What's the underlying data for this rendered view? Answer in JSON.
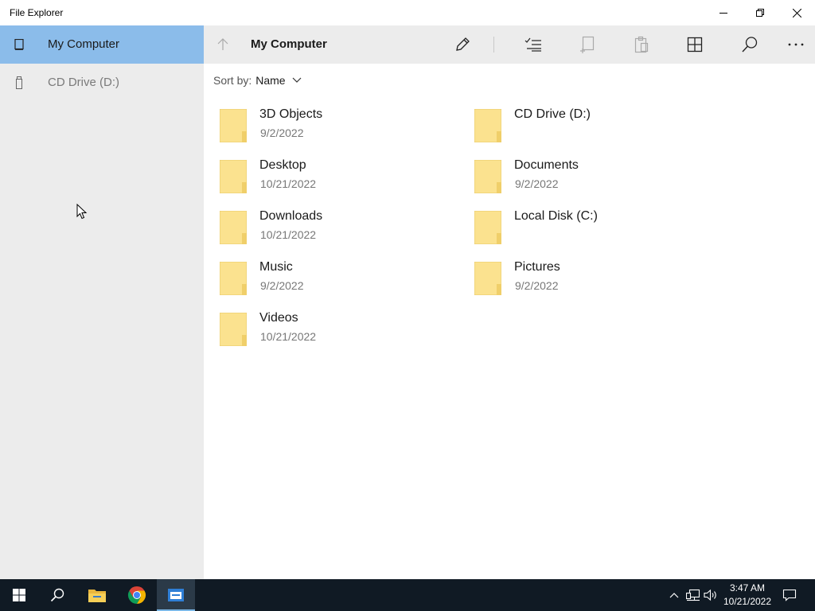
{
  "window": {
    "title": "File Explorer"
  },
  "sidebar": {
    "items": [
      {
        "label": "My Computer",
        "icon": "computer-icon",
        "selected": true
      },
      {
        "label": "CD Drive (D:)",
        "icon": "drive-icon",
        "selected": false
      }
    ]
  },
  "toolbar": {
    "location": "My Computer",
    "commands": [
      "up-arrow-icon",
      "rename-icon",
      "select-icon",
      "new-icon",
      "paste-icon",
      "view-icon",
      "search-icon",
      "more-icon"
    ]
  },
  "sort": {
    "label": "Sort by:",
    "value": "Name"
  },
  "items": [
    {
      "name": "3D Objects",
      "date": "9/2/2022"
    },
    {
      "name": "CD Drive (D:)",
      "date": ""
    },
    {
      "name": "Desktop",
      "date": "10/21/2022"
    },
    {
      "name": "Documents",
      "date": "9/2/2022"
    },
    {
      "name": "Downloads",
      "date": "10/21/2022"
    },
    {
      "name": "Local Disk (C:)",
      "date": ""
    },
    {
      "name": "Music",
      "date": "9/2/2022"
    },
    {
      "name": "Pictures",
      "date": "9/2/2022"
    },
    {
      "name": "Videos",
      "date": "10/21/2022"
    }
  ],
  "taskbar": {
    "apps": [
      "windows-start-icon",
      "search-icon",
      "file-explorer-icon",
      "chrome-icon",
      "files-app-icon"
    ],
    "clock": {
      "time": "3:47 AM",
      "date": "10/21/2022"
    }
  },
  "colors": {
    "selected": "#8bbcea",
    "sidebar_bg": "#ececec",
    "folder": "#fbe28f",
    "taskbar": "#101a24"
  }
}
